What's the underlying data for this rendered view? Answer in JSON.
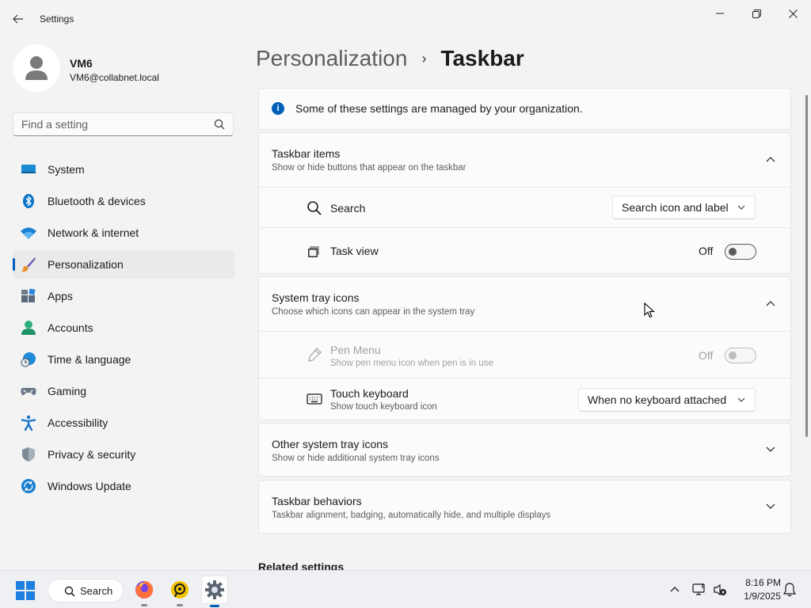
{
  "window": {
    "app_title": "Settings",
    "icons": {
      "back": "back-arrow-icon",
      "minimize": "minimize-icon",
      "maximize": "maximize-icon",
      "close": "close-icon"
    }
  },
  "profile": {
    "name": "VM6",
    "email": "VM6@collabnet.local"
  },
  "search": {
    "placeholder": "Find a setting"
  },
  "nav": {
    "items": [
      {
        "label": "System",
        "icon": "system-icon",
        "active": false
      },
      {
        "label": "Bluetooth & devices",
        "icon": "bluetooth-icon",
        "active": false
      },
      {
        "label": "Network & internet",
        "icon": "wifi-icon",
        "active": false
      },
      {
        "label": "Personalization",
        "icon": "brush-icon",
        "active": true
      },
      {
        "label": "Apps",
        "icon": "apps-icon",
        "active": false
      },
      {
        "label": "Accounts",
        "icon": "person-icon",
        "active": false
      },
      {
        "label": "Time & language",
        "icon": "clock-globe-icon",
        "active": false
      },
      {
        "label": "Gaming",
        "icon": "gamepad-icon",
        "active": false
      },
      {
        "label": "Accessibility",
        "icon": "accessibility-icon",
        "active": false
      },
      {
        "label": "Privacy & security",
        "icon": "shield-icon",
        "active": false
      },
      {
        "label": "Windows Update",
        "icon": "update-icon",
        "active": false
      }
    ],
    "accent": "#005fb8"
  },
  "breadcrumb": {
    "parent": "Personalization",
    "separator": "›",
    "current": "Taskbar"
  },
  "notice": {
    "text": "Some of these settings are managed by your organization."
  },
  "sections": {
    "taskbar_items": {
      "title": "Taskbar items",
      "subtitle": "Show or hide buttons that appear on the taskbar",
      "expanded": true,
      "search": {
        "label": "Search",
        "value": "Search icon and label"
      },
      "task_view": {
        "label": "Task view",
        "state": "Off"
      }
    },
    "system_tray": {
      "title": "System tray icons",
      "subtitle": "Choose which icons can appear in the system tray",
      "expanded": true,
      "pen_menu": {
        "label": "Pen Menu",
        "subtitle": "Show pen menu icon when pen is in use",
        "state": "Off",
        "disabled": true
      },
      "touch_keyboard": {
        "label": "Touch keyboard",
        "subtitle": "Show touch keyboard icon",
        "value": "When no keyboard attached"
      }
    },
    "other_tray": {
      "title": "Other system tray icons",
      "subtitle": "Show or hide additional system tray icons",
      "expanded": false
    },
    "behaviors": {
      "title": "Taskbar behaviors",
      "subtitle": "Taskbar alignment, badging, automatically hide, and multiple displays",
      "expanded": false
    }
  },
  "related": {
    "title": "Related settings"
  },
  "taskbar": {
    "search_label": "Search",
    "apps": [
      "windows-start-icon",
      "firefox-icon",
      "remote-desktop-icon",
      "settings-gear-icon"
    ],
    "clock_time": "8:16 PM",
    "clock_date": "1/9/2025"
  }
}
